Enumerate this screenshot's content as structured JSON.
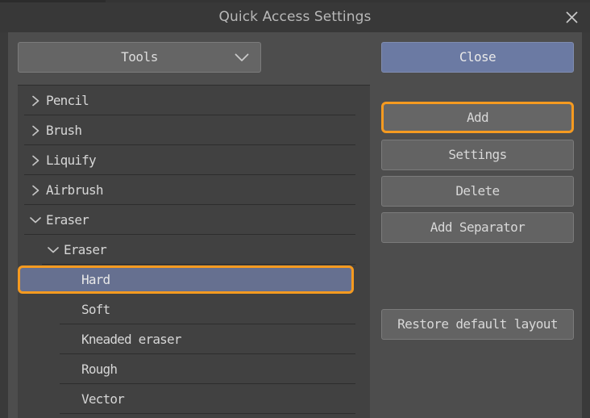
{
  "window": {
    "title": "Quick Access Settings",
    "close_icon": "close-x-icon"
  },
  "toolbar": {
    "category_dropdown": {
      "value": "Tools",
      "chevron_icon": "chevron-down-icon"
    }
  },
  "colors": {
    "dialog_background": "#4d4d4d",
    "frame": "#3a3a3a",
    "titlebar": "#383838",
    "list_background": "#414141",
    "button_face": "#636363",
    "accent_highlight": "#f59a20",
    "selection_blue": "#667090",
    "close_button_blue": "#6b7aa3",
    "text": "#d6d6d6",
    "separator": "#2d2d2d"
  },
  "tree": {
    "items": [
      {
        "label": "Pencil",
        "depth": 0,
        "expanded": false,
        "twisty": "chevron-right-icon",
        "selected": false
      },
      {
        "label": "Brush",
        "depth": 0,
        "expanded": false,
        "twisty": "chevron-right-icon",
        "selected": false
      },
      {
        "label": "Liquify",
        "depth": 0,
        "expanded": false,
        "twisty": "chevron-right-icon",
        "selected": false
      },
      {
        "label": "Airbrush",
        "depth": 0,
        "expanded": false,
        "twisty": "chevron-right-icon",
        "selected": false
      },
      {
        "label": "Eraser",
        "depth": 0,
        "expanded": true,
        "twisty": "chevron-down-icon",
        "selected": false
      },
      {
        "label": "Eraser",
        "depth": 1,
        "expanded": true,
        "twisty": "chevron-down-icon",
        "selected": false
      },
      {
        "label": "Hard",
        "depth": 2,
        "expanded": null,
        "twisty": "none",
        "selected": true
      },
      {
        "label": "Soft",
        "depth": 2,
        "expanded": null,
        "twisty": "none",
        "selected": false
      },
      {
        "label": "Kneaded eraser",
        "depth": 2,
        "expanded": null,
        "twisty": "none",
        "selected": false
      },
      {
        "label": "Rough",
        "depth": 2,
        "expanded": null,
        "twisty": "none",
        "selected": false
      },
      {
        "label": "Vector",
        "depth": 2,
        "expanded": null,
        "twisty": "none",
        "selected": false
      }
    ]
  },
  "scrollbar": {
    "up_arrow_icon": "chevron-up-icon",
    "orientation": "vertical"
  },
  "actions": {
    "close": "Close",
    "add": "Add",
    "settings": "Settings",
    "delete": "Delete",
    "add_separator": "Add Separator",
    "restore_default_layout": "Restore default layout"
  }
}
